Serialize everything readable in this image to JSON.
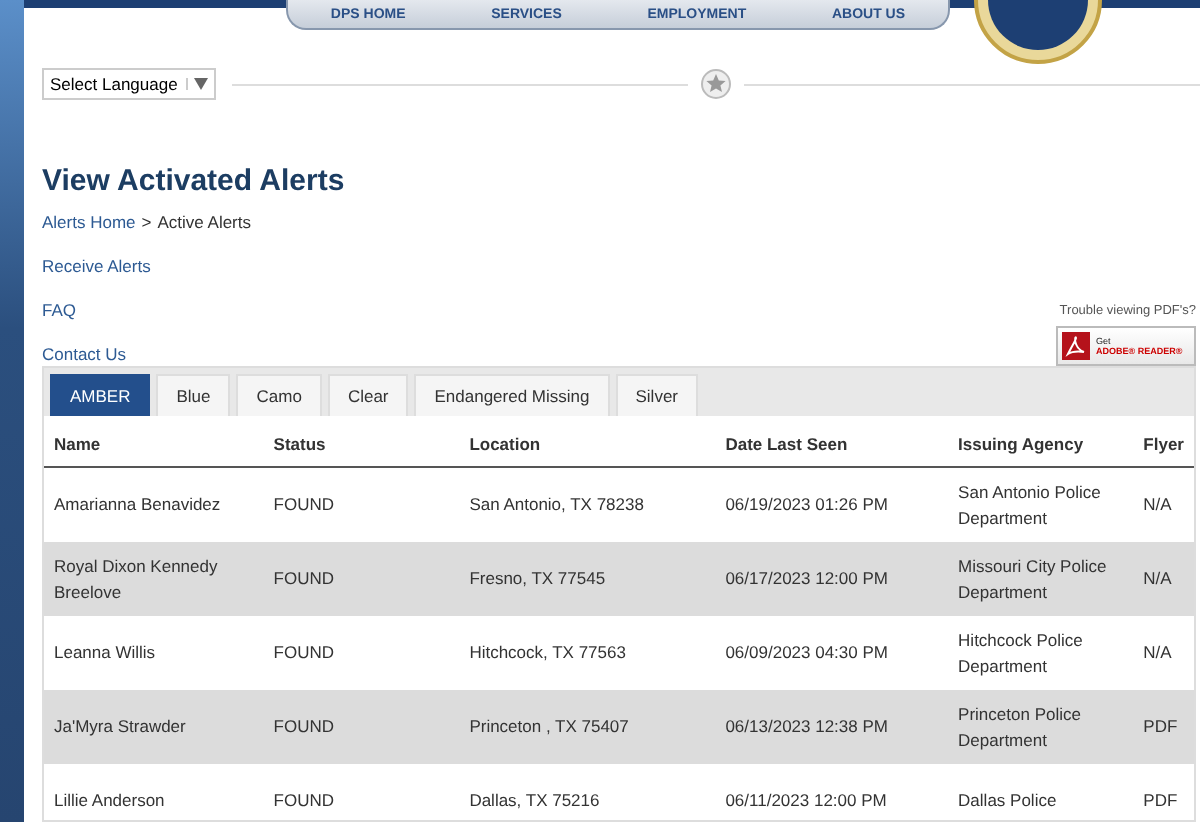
{
  "nav": {
    "links": [
      "DPS HOME",
      "SERVICES",
      "EMPLOYMENT",
      "ABOUT US"
    ]
  },
  "language_select": {
    "value": "Select Language"
  },
  "page_title": "View Activated Alerts",
  "breadcrumb": {
    "link": "Alerts Home",
    "separator": ">",
    "current": "Active Alerts"
  },
  "side_links": [
    "Receive Alerts",
    "FAQ",
    "Contact Us"
  ],
  "pdf_help": {
    "text": "Trouble viewing PDF's?",
    "badge_top": "Get",
    "badge_bottom": "ADOBE® READER®"
  },
  "tabs": [
    {
      "label": "AMBER",
      "selected": true
    },
    {
      "label": "Blue",
      "selected": false
    },
    {
      "label": "Camo",
      "selected": false
    },
    {
      "label": "Clear",
      "selected": false
    },
    {
      "label": "Endangered Missing",
      "selected": false
    },
    {
      "label": "Silver",
      "selected": false
    }
  ],
  "table": {
    "columns": [
      "Name",
      "Status",
      "Location",
      "Date Last Seen",
      "Issuing Agency",
      "Flyer"
    ],
    "rows": [
      [
        "Amarianna Benavidez",
        "FOUND",
        "San Antonio, TX 78238",
        "06/19/2023 01:26 PM",
        "San Antonio Police Department",
        "N/A"
      ],
      [
        "Royal Dixon Kennedy Breelove",
        "FOUND",
        "Fresno, TX 77545",
        "06/17/2023 12:00 PM",
        "Missouri City Police Department",
        "N/A"
      ],
      [
        "Leanna Willis",
        "FOUND",
        "Hitchcock, TX 77563",
        "06/09/2023 04:30 PM",
        "Hitchcock Police Department",
        "N/A"
      ],
      [
        "Ja'Myra Strawder",
        "FOUND",
        "Princeton , TX 75407",
        "06/13/2023 12:38 PM",
        "Princeton Police Department",
        "PDF"
      ],
      [
        "Lillie Anderson",
        "FOUND",
        "Dallas, TX 75216",
        "06/11/2023 12:00 PM",
        "Dallas Police",
        "PDF"
      ]
    ]
  }
}
